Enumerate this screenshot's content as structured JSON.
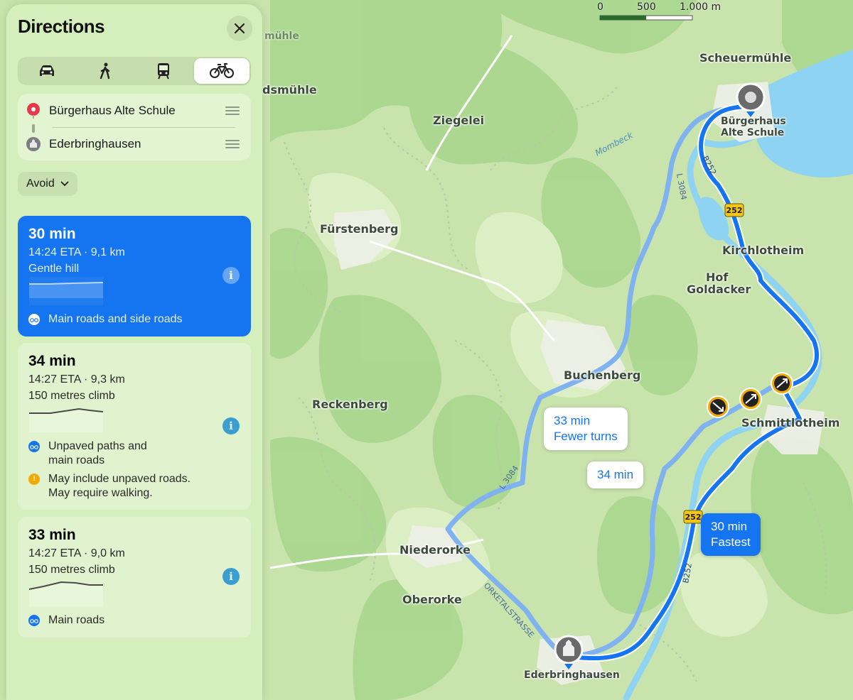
{
  "sidebar": {
    "title": "Directions",
    "modes": [
      "car-icon",
      "walk-icon",
      "transit-icon",
      "bicycle-icon"
    ],
    "active_mode": "bicycle",
    "stops": [
      {
        "label": "Bürgerhaus Alte Schule",
        "icon": "red-pin-icon"
      },
      {
        "label": "Ederbringhausen",
        "icon": "city-icon"
      }
    ],
    "avoid_label": "Avoid",
    "routes": [
      {
        "time": "30 min",
        "eta_distance": "14:24 ETA · 9,1 km",
        "climb": "Gentle hill",
        "note": "Main roads and side roads",
        "selected": true
      },
      {
        "time": "34 min",
        "eta_distance": "14:27 ETA · 9,3 km",
        "climb": "150 metres climb",
        "note": "Unpaved paths and main roads",
        "warning": "May include unpaved roads. May require walking."
      },
      {
        "time": "33 min",
        "eta_distance": "14:27 ETA · 9,0 km",
        "climb": "150 metres climb",
        "note": "Main roads"
      }
    ]
  },
  "map": {
    "scale": {
      "zero": "0",
      "mid": "500",
      "max": "1.000 m"
    },
    "places": {
      "scheuermuhle": "Scheuermühle",
      "dsmuhle": "dsmühle",
      "muhle_top": "mühle",
      "ziegelei": "Ziegelei",
      "furstenberg": "Fürstenberg",
      "kirchlotheim": "Kirchlotheim",
      "hof": "Hof",
      "goldacker": "Goldacker",
      "buchenberg": "Buchenberg",
      "reckenberg": "Reckenberg",
      "schmittlotheim": "Schmittlotheim",
      "niederorke": "Niederorke",
      "oberorke": "Oberorke",
      "ederbringhausen": "Ederbringhausen",
      "origin_line1": "Bürgerhaus",
      "origin_line2": "Alte Schule",
      "mombeck": "Mombeck"
    },
    "road_labels": {
      "l3084_top": "L 3084",
      "l3084_bottom": "L 3084",
      "b252": "B252",
      "b252_lower": "B252",
      "orketalstrasse": "ORKETALSTRASSE",
      "shield_252": "252"
    },
    "callouts": [
      {
        "time": "33 min",
        "sub": "Fewer turns"
      },
      {
        "time": "34 min"
      },
      {
        "time": "30 min",
        "sub": "Fastest"
      }
    ]
  },
  "colors": {
    "accent": "#1574f0",
    "route_alt": "#7fb2ef",
    "water": "#8fd3f2"
  }
}
